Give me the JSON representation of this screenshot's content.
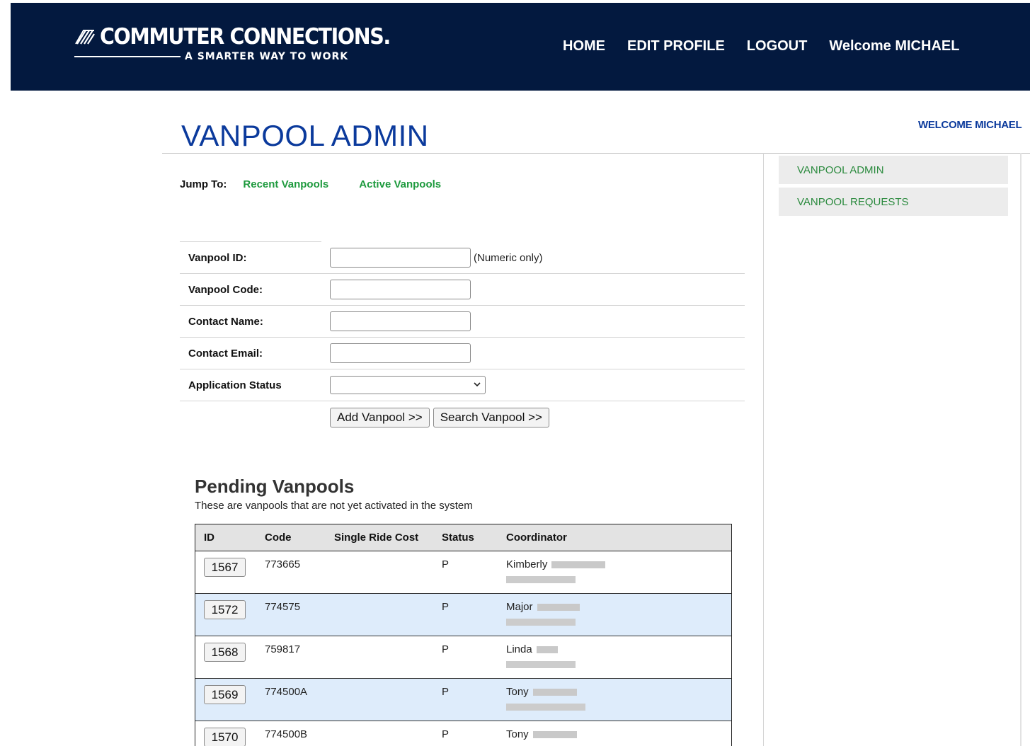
{
  "header": {
    "logo_name": "COMMUTER CONNECTIONS.",
    "logo_tagline": "A SMARTER WAY TO WORK",
    "nav": [
      {
        "label": "HOME"
      },
      {
        "label": "EDIT PROFILE"
      },
      {
        "label": "LOGOUT"
      }
    ],
    "welcome": "Welcome MICHAEL"
  },
  "page": {
    "title": "VANPOOL ADMIN",
    "welcome_right": "WELCOME MICHAEL"
  },
  "sidebar": {
    "items": [
      {
        "label": "VANPOOL ADMIN"
      },
      {
        "label": "VANPOOL REQUESTS"
      }
    ]
  },
  "jump": {
    "label": "Jump To:",
    "links": [
      {
        "label": "Recent Vanpools"
      },
      {
        "label": "Active Vanpools"
      }
    ]
  },
  "search_form": {
    "vanpool_id": {
      "label": "Vanpool ID:",
      "value": "",
      "hint": "(Numeric only)"
    },
    "vanpool_code": {
      "label": "Vanpool Code:",
      "value": ""
    },
    "contact_name": {
      "label": "Contact Name:",
      "value": ""
    },
    "contact_email": {
      "label": "Contact Email:",
      "value": ""
    },
    "application_status": {
      "label": "Application Status",
      "selected": ""
    },
    "add_button": "Add Vanpool >>",
    "search_button": "Search Vanpool >>"
  },
  "pending": {
    "title": "Pending Vanpools",
    "subtitle": "These are vanpools that are not yet activated in the system",
    "columns": [
      "ID",
      "Code",
      "Single Ride Cost",
      "Status",
      "Coordinator"
    ],
    "rows": [
      {
        "id": "1567",
        "code": "773665",
        "cost": "",
        "status": "P",
        "coordinator": "Kimberly"
      },
      {
        "id": "1572",
        "code": "774575",
        "cost": "",
        "status": "P",
        "coordinator": "Major"
      },
      {
        "id": "1568",
        "code": "759817",
        "cost": "",
        "status": "P",
        "coordinator": "Linda"
      },
      {
        "id": "1569",
        "code": "774500A",
        "cost": "",
        "status": "P",
        "coordinator": "Tony"
      },
      {
        "id": "1570",
        "code": "774500B",
        "cost": "",
        "status": "P",
        "coordinator": "Tony"
      }
    ]
  },
  "colors": {
    "header_bg": "#03193f",
    "title_blue": "#0b3a9c",
    "link_green": "#1e9a3e",
    "row_alt": "#deecfb"
  }
}
